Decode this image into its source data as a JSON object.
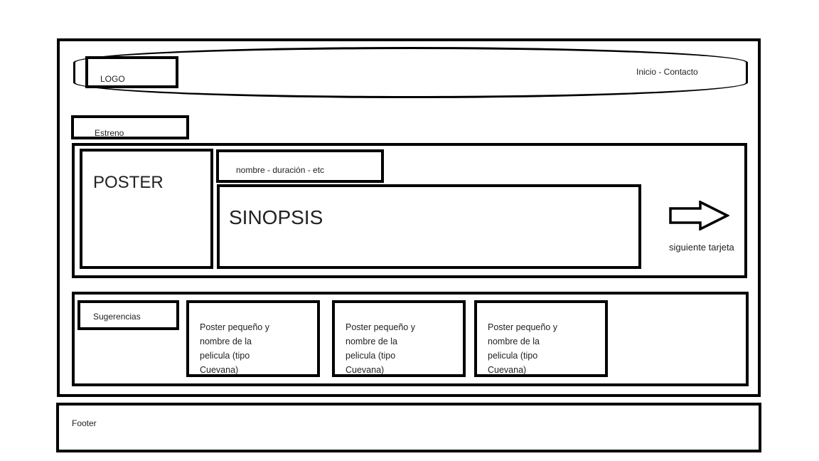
{
  "header": {
    "logo_label": "LOGO",
    "nav_label": "Inicio - Contacto"
  },
  "estreno": {
    "tab_label": "Estreno",
    "poster_label": "POSTER",
    "meta_label": "nombre - duración - etc",
    "synopsis_label": "SINOPSIS",
    "next_label": "siguiente tarjeta",
    "next_icon": "arrow-right-icon"
  },
  "sugerencias": {
    "tab_label": "Sugerencias",
    "cards": [
      {
        "text": "Poster pequeño y\nnombre de la\npelicula (tipo\nCuevana)"
      },
      {
        "text": "Poster pequeño y\nnombre de la\npelicula (tipo\nCuevana)"
      },
      {
        "text": "Poster pequeño y\nnombre de la\npelicula (tipo\nCuevana)"
      }
    ]
  },
  "footer": {
    "label": "Footer"
  },
  "colors": {
    "stroke": "#000000",
    "text": "#222222",
    "background": "#ffffff"
  }
}
